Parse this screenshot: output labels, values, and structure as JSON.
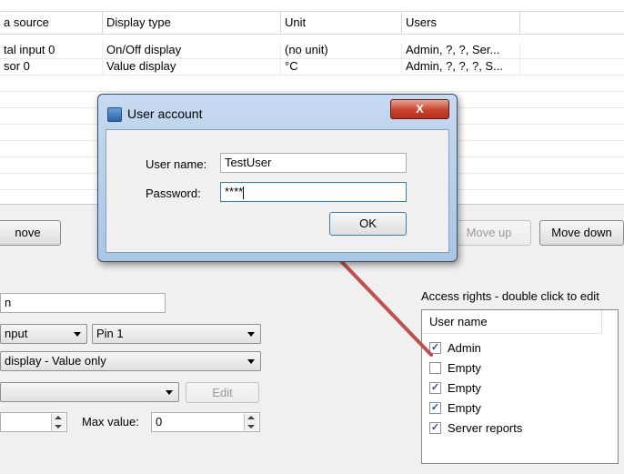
{
  "grid": {
    "columns": [
      "a source",
      "Display type",
      "Unit",
      "Users"
    ],
    "rows": [
      {
        "source": "tal input 0",
        "display_type": "On/Off display",
        "unit": "(no unit)",
        "users": "Admin, ?, ?, Ser..."
      },
      {
        "source": "sor 0",
        "display_type": "Value display",
        "unit": "°C",
        "users": "Admin, ?, ?, ?, S..."
      }
    ]
  },
  "buttons": {
    "remove": "nove",
    "move_up": "Move up",
    "move_down": "Move down",
    "edit": "Edit"
  },
  "form": {
    "name_value": "n",
    "input_type": "nput",
    "pin": "Pin 1",
    "display_mode": "display - Value only",
    "combo_blank": "",
    "min_value": "",
    "max_label": "Max value:",
    "max_value": "0"
  },
  "access": {
    "title": "Access rights - double click to edit",
    "header": "User name",
    "users": [
      {
        "name": "Admin",
        "checked": true
      },
      {
        "name": "Empty",
        "checked": false
      },
      {
        "name": "Empty",
        "checked": true
      },
      {
        "name": "Empty",
        "checked": true
      },
      {
        "name": "Server reports",
        "checked": true
      }
    ]
  },
  "dialog": {
    "title": "User account",
    "close_label": "X",
    "username_label": "User name:",
    "username_value": "TestUser",
    "password_label": "Password:",
    "password_value": "****",
    "ok_label": "OK"
  },
  "colors": {
    "arrow": "#c0504d",
    "dialog_frame": "#b3cbe8"
  }
}
